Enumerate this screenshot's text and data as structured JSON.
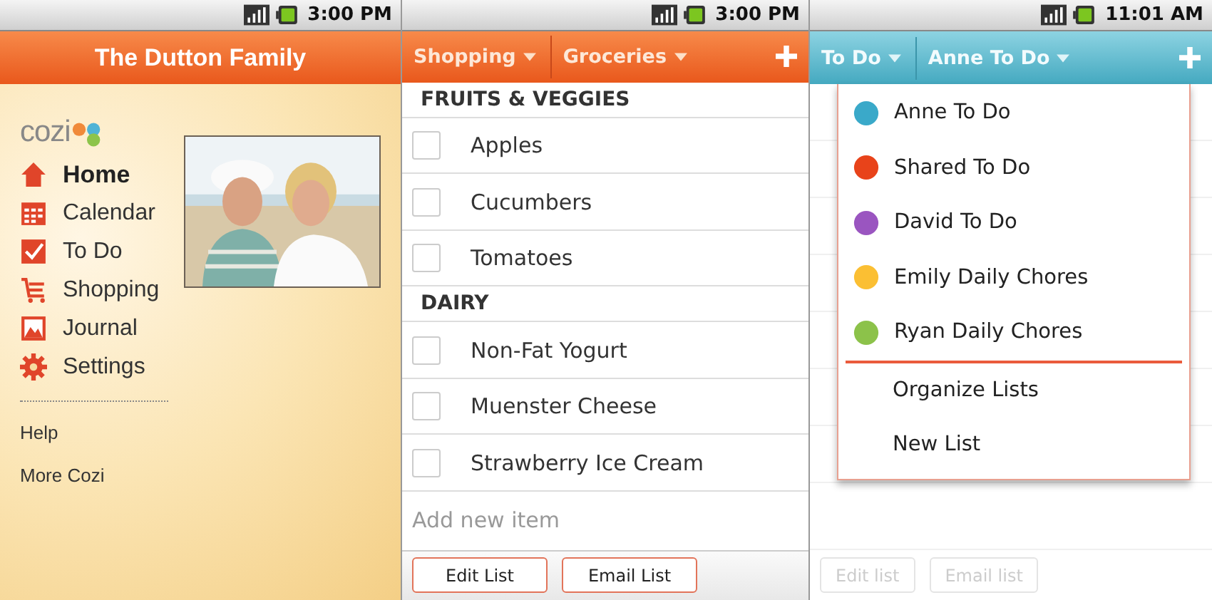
{
  "home_screen": {
    "status_bar": {
      "time": "3:00 PM"
    },
    "title": "The Dutton Family",
    "logo": "cozi",
    "nav": [
      {
        "label": "Home",
        "selected": true
      },
      {
        "label": "Calendar",
        "selected": false
      },
      {
        "label": "To Do",
        "selected": false
      },
      {
        "label": "Shopping",
        "selected": false
      },
      {
        "label": "Journal",
        "selected": false
      },
      {
        "label": "Settings",
        "selected": false
      }
    ],
    "links": [
      "Help",
      "More Cozi"
    ]
  },
  "shopping_screen": {
    "status_bar": {
      "time": "3:00 PM"
    },
    "dropdowns": [
      "Shopping",
      "Groceries"
    ],
    "sections": [
      {
        "title": "FRUITS & VEGGIES",
        "items": [
          {
            "label": "Apples",
            "checked": false
          },
          {
            "label": "Cucumbers",
            "checked": false
          },
          {
            "label": "Tomatoes",
            "checked": false
          }
        ]
      },
      {
        "title": "DAIRY",
        "items": [
          {
            "label": "Non-Fat Yogurt",
            "checked": false
          },
          {
            "label": "Muenster Cheese",
            "checked": false
          },
          {
            "label": "Strawberry Ice Cream",
            "checked": false
          }
        ]
      }
    ],
    "add_item": {
      "placeholder": "Add new item"
    },
    "buttons": [
      {
        "label": "Edit List",
        "disabled": false
      },
      {
        "label": "Email List",
        "disabled": false
      }
    ]
  },
  "todo_screen": {
    "status_bar": {
      "time": "11:01 AM"
    },
    "dropdowns": [
      "To Do",
      "Anne To Do"
    ],
    "menu": {
      "lists": [
        {
          "label": "Anne To Do",
          "color": "#3aa9c9"
        },
        {
          "label": "Shared To Do",
          "color": "#e8431a"
        },
        {
          "label": "David To Do",
          "color": "#9a55c0"
        },
        {
          "label": "Emily Daily Chores",
          "color": "#fbbf33"
        },
        {
          "label": "Ryan Daily Chores",
          "color": "#8cc24a"
        }
      ],
      "actions": [
        "Organize Lists",
        "New List"
      ]
    },
    "buttons": [
      {
        "label": "Edit list",
        "disabled": true
      },
      {
        "label": "Email list",
        "disabled": true
      }
    ]
  }
}
